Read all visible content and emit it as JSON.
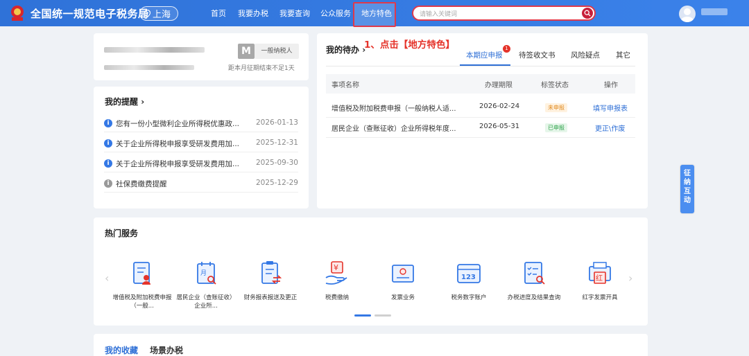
{
  "header": {
    "site_title": "全国统一规范电子税务局",
    "location": "上海",
    "nav": [
      "首页",
      "我要办税",
      "我要查询",
      "公众服务",
      "地方特色"
    ],
    "search_placeholder": "请输入关键词",
    "colors": {
      "bar": "#2f72d8",
      "highlight": "#e0394a"
    }
  },
  "profile": {
    "taxpayer_badge": "M",
    "taxpayer_type": "一般纳税人",
    "deadline_note": "距本月征期结束不足1天"
  },
  "reminders": {
    "title": "我的提醒",
    "items": [
      {
        "text": "您有一份小型微利企业所得税优惠政...",
        "date": "2026-01-13"
      },
      {
        "text": "关于企业所得税申报享受研发费用加...",
        "date": "2025-12-31"
      },
      {
        "text": "关于企业所得税申报享受研发费用加...",
        "date": "2025-09-30"
      },
      {
        "text": "社保费缴费提醒",
        "date": "2025-12-29"
      }
    ]
  },
  "todo": {
    "title": "我的待办",
    "annotation": "1、点击【地方特色】",
    "tabs": [
      "本期应申报",
      "待签收文书",
      "风险疑点",
      "其它"
    ],
    "tab_badge": "1",
    "columns": [
      "事项名称",
      "办理期限",
      "标签状态",
      "操作"
    ],
    "rows": [
      {
        "name": "增值税及附加税费申报（一般纳税人适...",
        "deadline": "2026-02-24",
        "status": "未申报",
        "action": "填写申报表"
      },
      {
        "name": "居民企业（查账征收）企业所得税年度...",
        "deadline": "2026-05-31",
        "status": "已申报",
        "action": "更正\\作废"
      }
    ]
  },
  "hot_services": {
    "title": "热门服务",
    "items": [
      {
        "label": "增值税及附加税费申报（一般...",
        "icon": "vat-declaration-icon"
      },
      {
        "label": "居民企业（查账征收）企业所...",
        "icon": "calendar-search-icon"
      },
      {
        "label": "财务报表报送及更正",
        "icon": "report-exchange-icon"
      },
      {
        "label": "税费缴纳",
        "icon": "tax-payment-icon"
      },
      {
        "label": "发票业务",
        "icon": "invoice-icon"
      },
      {
        "label": "税务数字账户",
        "icon": "digital-account-icon"
      },
      {
        "label": "办税进度及结果查询",
        "icon": "progress-query-icon"
      },
      {
        "label": "红字发票开具",
        "icon": "red-invoice-icon"
      }
    ]
  },
  "side_tab": "征纳互动",
  "bottom_tabs": [
    "我的收藏",
    "场景办税"
  ]
}
